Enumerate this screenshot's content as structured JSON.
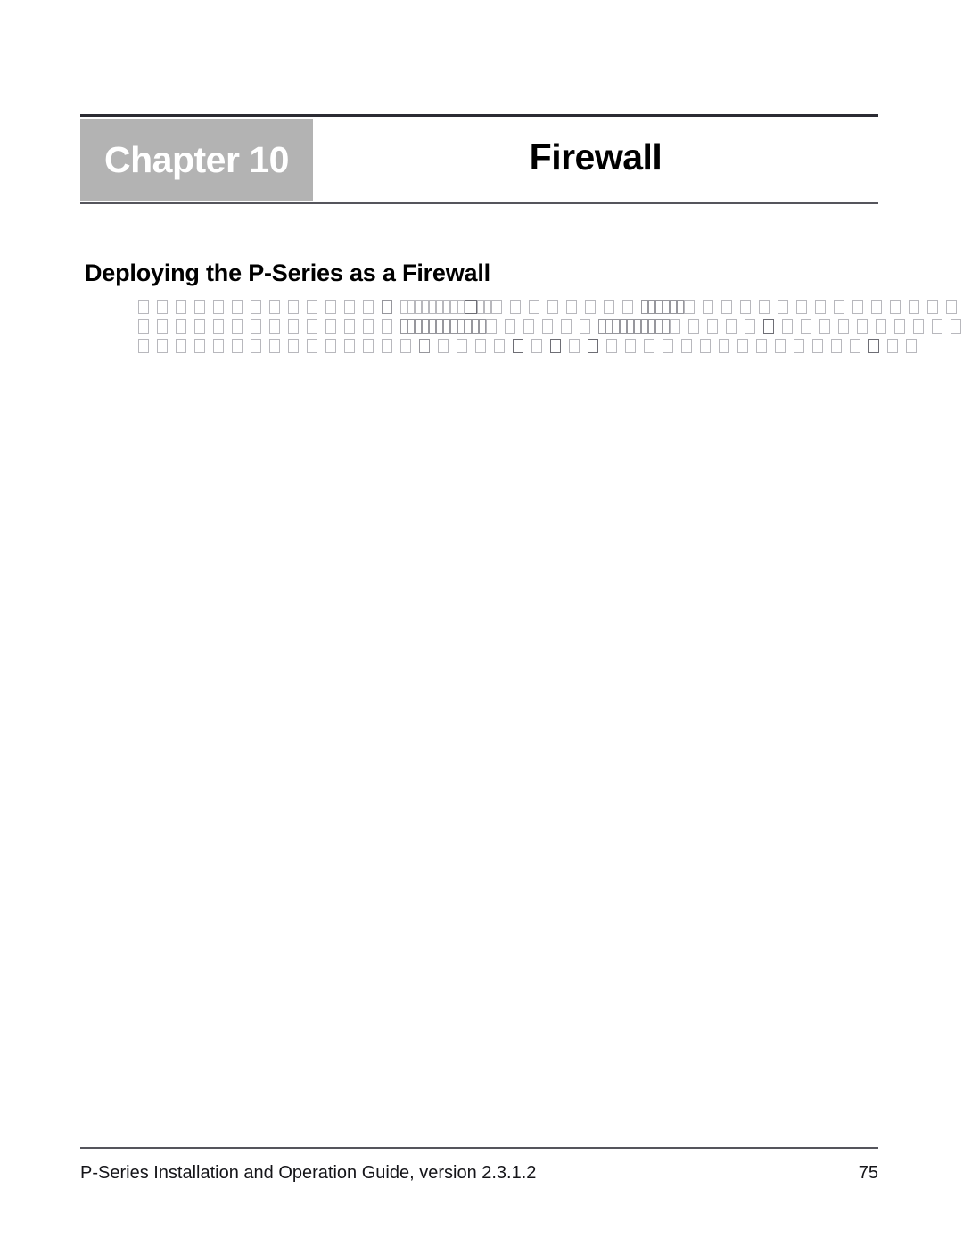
{
  "document": {
    "page_background": "#ffffff",
    "accent_gray": "#b3b3b3",
    "rule_color": "#2b2b33"
  },
  "header": {
    "chapter_label": "Chapter 10",
    "chapter_title": "Firewall"
  },
  "section": {
    "heading": "Deploying the P-Series as a Firewall"
  },
  "body": {
    "note": "Body text renders as missing-glyph boxes",
    "lines": [
      {
        "runs": [
          {
            "count": 13,
            "style": "spaced",
            "shade": "light"
          },
          {
            "count": 1,
            "style": "spaced",
            "shade": "mid"
          },
          {
            "count": 9,
            "style": "tight",
            "shade": "light",
            "width": "narrow"
          },
          {
            "count": 1,
            "style": "tight",
            "shade": "dark",
            "width": "wide"
          },
          {
            "count": 2,
            "style": "tight",
            "shade": "light",
            "width": "narrow"
          },
          {
            "count": 8,
            "style": "spaced",
            "shade": "light"
          },
          {
            "count": 6,
            "style": "tight",
            "shade": "mid",
            "width": "narrow"
          },
          {
            "count": 16,
            "style": "spaced",
            "shade": "light"
          }
        ]
      },
      {
        "runs": [
          {
            "count": 14,
            "style": "spaced",
            "shade": "light"
          },
          {
            "count": 12,
            "style": "tight",
            "shade": "mid",
            "width": "narrow"
          },
          {
            "count": 6,
            "style": "spaced",
            "shade": "light"
          },
          {
            "count": 10,
            "style": "tight",
            "shade": "mid",
            "width": "narrow"
          },
          {
            "count": 5,
            "style": "spaced",
            "shade": "light"
          },
          {
            "count": 1,
            "style": "spaced",
            "shade": "dark"
          },
          {
            "count": 12,
            "style": "spaced",
            "shade": "light"
          }
        ]
      },
      {
        "runs": [
          {
            "count": 15,
            "style": "spaced",
            "shade": "light"
          },
          {
            "count": 1,
            "style": "spaced",
            "shade": "mid"
          },
          {
            "count": 4,
            "style": "spaced",
            "shade": "light"
          },
          {
            "count": 1,
            "style": "spaced",
            "shade": "dark"
          },
          {
            "count": 1,
            "style": "spaced",
            "shade": "light"
          },
          {
            "count": 1,
            "style": "spaced",
            "shade": "dark"
          },
          {
            "count": 1,
            "style": "spaced",
            "shade": "light"
          },
          {
            "count": 1,
            "style": "spaced",
            "shade": "dark"
          },
          {
            "count": 14,
            "style": "spaced",
            "shade": "light"
          },
          {
            "count": 1,
            "style": "spaced",
            "shade": "dark"
          },
          {
            "count": 2,
            "style": "spaced",
            "shade": "light"
          }
        ]
      }
    ]
  },
  "footer": {
    "text": "P-Series Installation and Operation Guide, version 2.3.1.2",
    "page_number": "75"
  }
}
